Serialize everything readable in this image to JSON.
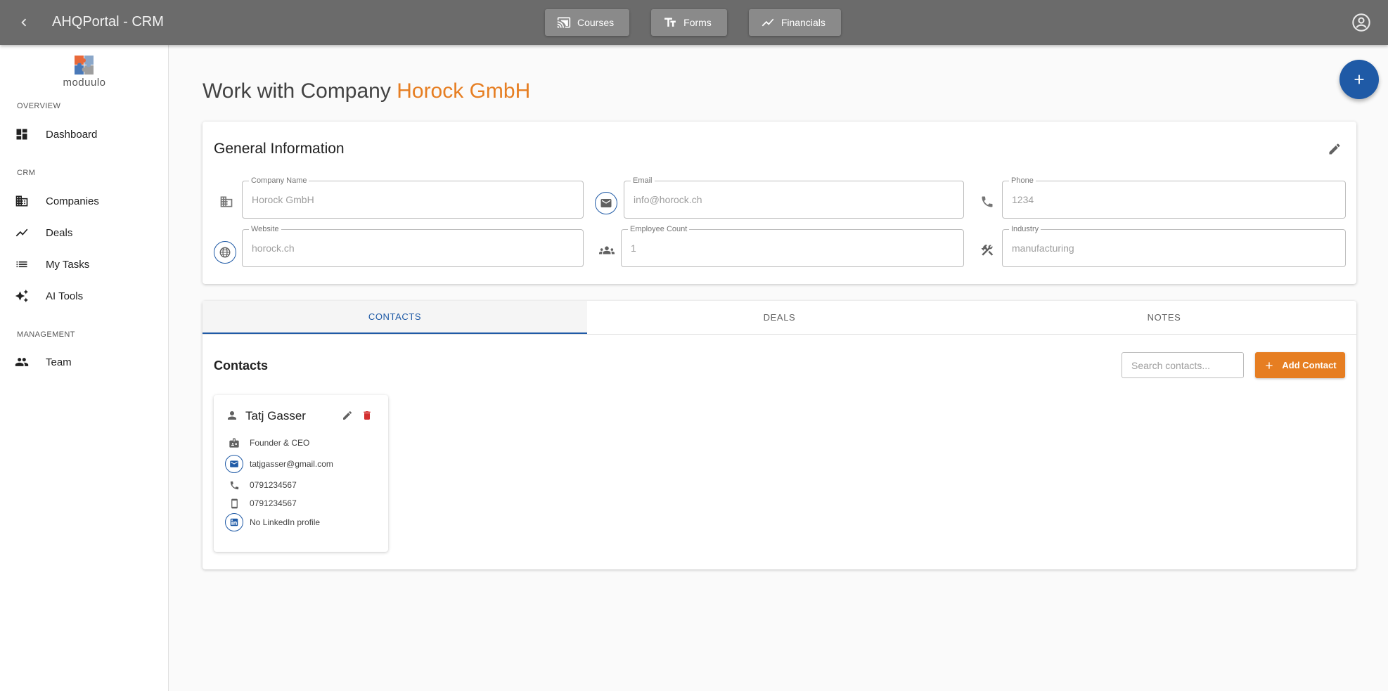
{
  "app": {
    "title": "AHQPortal - CRM",
    "nav": [
      {
        "label": "Courses",
        "icon": "cast-for-education-icon"
      },
      {
        "label": "Forms",
        "icon": "text-fields-icon"
      },
      {
        "label": "Financials",
        "icon": "trending-up-icon"
      }
    ]
  },
  "sidebar": {
    "logo_text": "moduulo",
    "sections": {
      "overview": "OVERVIEW",
      "crm": "CRM",
      "management": "MANAGEMENT"
    },
    "items": [
      {
        "label": "Dashboard",
        "icon": "dashboard-icon"
      },
      {
        "label": "Companies",
        "icon": "business-icon"
      },
      {
        "label": "Deals",
        "icon": "trending-up-icon"
      },
      {
        "label": "My Tasks",
        "icon": "list-icon"
      },
      {
        "label": "AI Tools",
        "icon": "sparkle-icon"
      },
      {
        "label": "Team",
        "icon": "people-icon"
      }
    ]
  },
  "page": {
    "title_prefix": "Work with Company",
    "company_name": "Horock GmbH"
  },
  "general": {
    "title": "General Information",
    "fields": {
      "company_name": {
        "label": "Company Name",
        "value": "Horock GmbH"
      },
      "email": {
        "label": "Email",
        "value": "info@horock.ch"
      },
      "phone": {
        "label": "Phone",
        "value": "1234"
      },
      "website": {
        "label": "Website",
        "value": "horock.ch"
      },
      "employee_count": {
        "label": "Employee Count",
        "value": "1"
      },
      "industry": {
        "label": "Industry",
        "value": "manufacturing"
      }
    }
  },
  "tabs": [
    "CONTACTS",
    "DEALS",
    "NOTES"
  ],
  "active_tab": "CONTACTS",
  "contacts_section": {
    "title": "Contacts",
    "search_placeholder": "Search contacts...",
    "add_label": "Add Contact"
  },
  "contacts": [
    {
      "name": "Tatj Gasser",
      "role": "Founder & CEO",
      "email": "tatjgasser@gmail.com",
      "phone": "0791234567",
      "mobile": "0791234567",
      "linkedin": "No LinkedIn profile"
    }
  ],
  "colors": {
    "accent_blue": "#1f5aa6",
    "accent_orange": "#e67e22",
    "topbar": "#6b6b6b",
    "delete_red": "#d32f2f"
  }
}
